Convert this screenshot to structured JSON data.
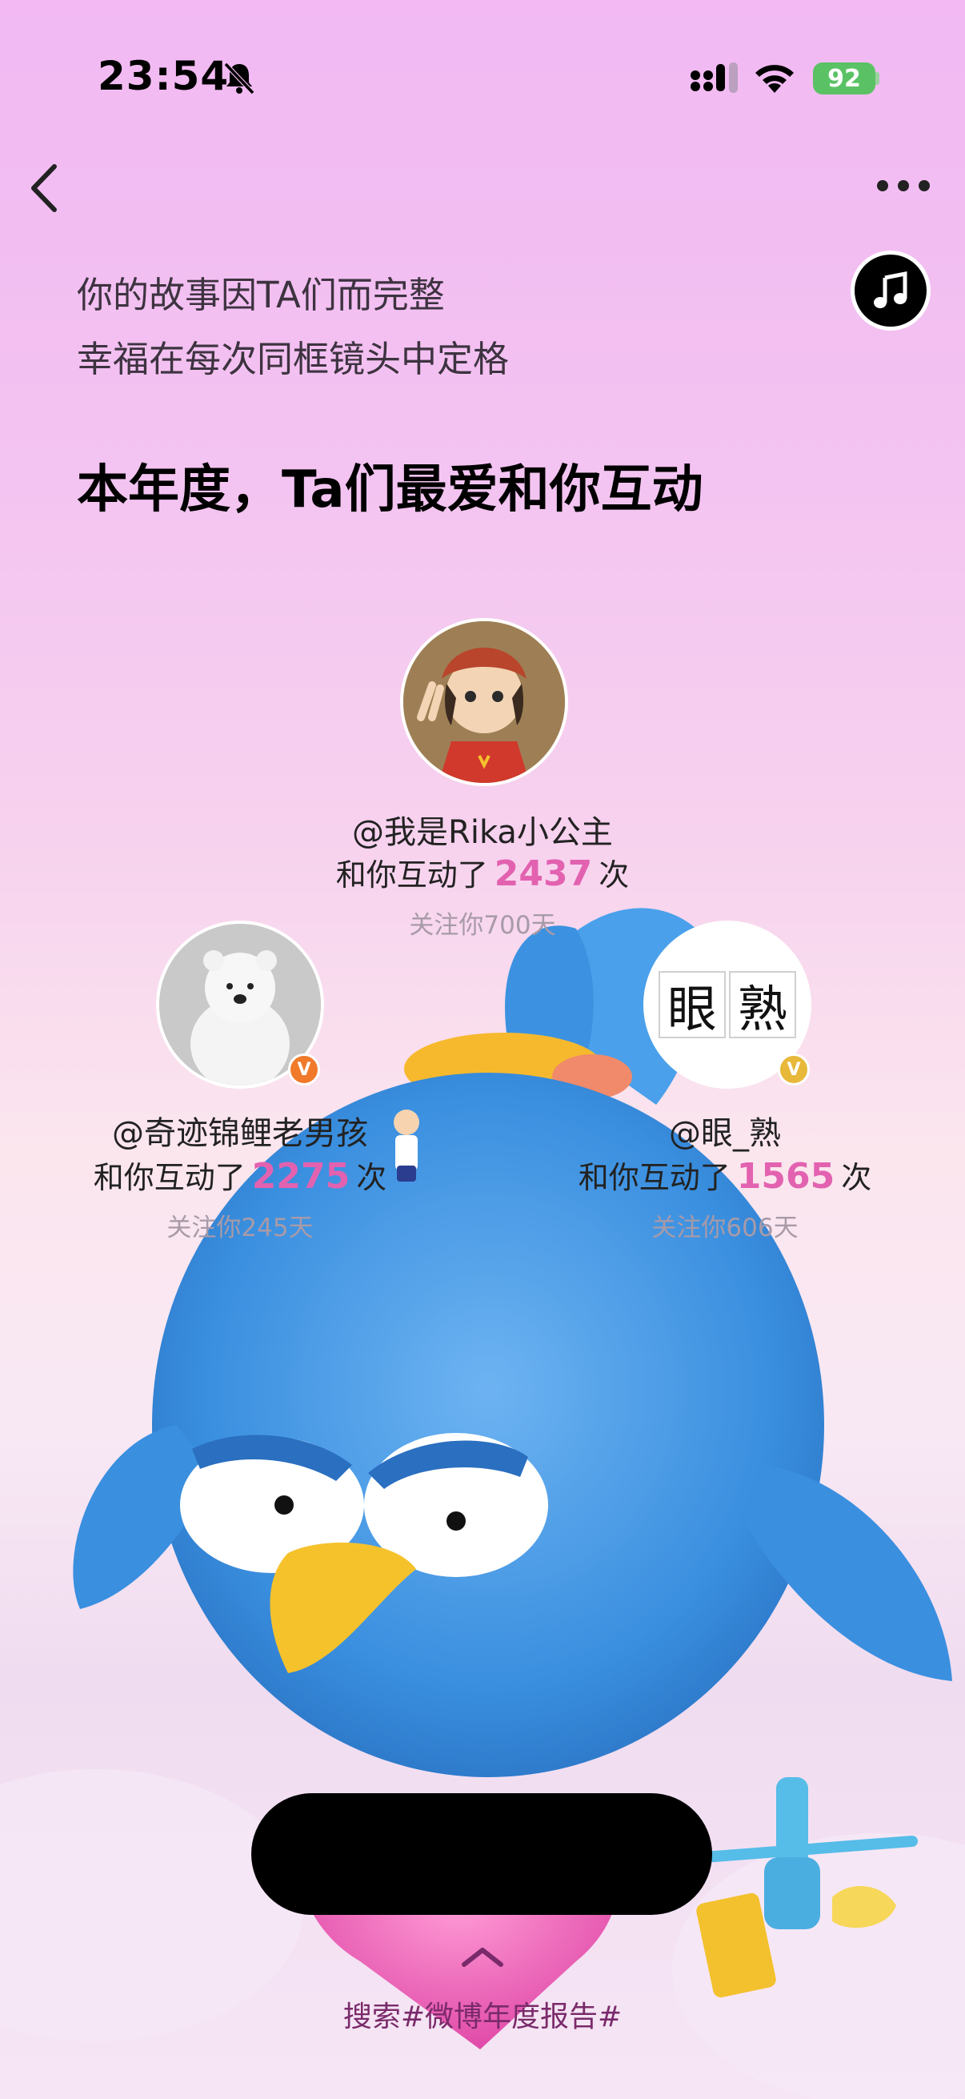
{
  "status_bar": {
    "time": "23:54",
    "battery": "92",
    "icons": [
      "bell-muted-icon",
      "cellular-signal-icon",
      "wifi-icon",
      "battery-charging-icon"
    ]
  },
  "nav": {
    "back_icon": "chevron-left-icon",
    "more_icon": "more-dots-icon",
    "music_icon": "music-note-icon"
  },
  "intro": {
    "line1": "你的故事因TA们而完整",
    "line2": "幸福在每次同框镜头中定格"
  },
  "heading": "本年度，Ta们最爱和你互动",
  "interaction_prefix": "和你互动了",
  "interaction_suffix": "次",
  "users": [
    {
      "name": "@我是Rika小公主",
      "count": "2437",
      "follow": "关注你700天"
    },
    {
      "name": "@奇迹锦鲤老男孩",
      "count": "2275",
      "follow": "关注你245天",
      "badge": "V"
    },
    {
      "name": "@眼_熟",
      "count": "1565",
      "follow": "关注你606天",
      "badge": "V",
      "avatar_text": [
        "眼",
        "熟"
      ]
    }
  ],
  "footer": {
    "hint": "搜索#微博年度报告#",
    "chevron_icon": "chevron-up-icon"
  },
  "colors": {
    "accent_count": "#e262b0",
    "bird_blue": "#3a8fdf",
    "beak_yellow": "#f6c22c",
    "badge_orange": "#f07a2a",
    "badge_gold": "#e8b83a"
  }
}
